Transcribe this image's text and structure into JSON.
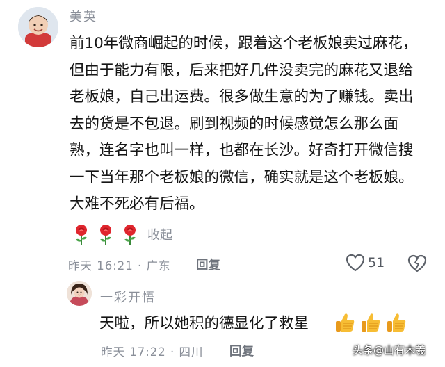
{
  "comment": {
    "username": "美英",
    "text": "前10年微商崛起的时候，跟着这个老板娘卖过麻花，但由于能力有限，后来把好几件没卖完的麻花又退给老板娘，自己出运费。很多做生意的为了赚钱。卖出去的货是不包退。刷到视频的时候感觉怎么那么面熟，连名字也叫一样，也都在长沙。好奇打开微信搜一下当年那个老板娘的微信，确实就是这个老板娘。大难不死必有后福。",
    "emoji_icons": [
      "rose-icon",
      "rose-icon",
      "rose-icon"
    ],
    "collapse_label": "收起",
    "meta": "昨天 16:21 · 广东",
    "reply_label": "回复",
    "like_count": "51"
  },
  "reply": {
    "username": "一彩开悟",
    "text": "天啦，所以她积的德显化了救星",
    "emoji_icons": [
      "thumbs-up-icon",
      "thumbs-up-icon",
      "thumbs-up-icon"
    ],
    "meta": "昨天 17:22 · 四川",
    "reply_label": "回复"
  },
  "watermark": "头条@山有木羲",
  "colors": {
    "text": "#151515",
    "secondary": "#8a8f99",
    "rose": "#e0262e",
    "thumb": "#f5b52c"
  }
}
